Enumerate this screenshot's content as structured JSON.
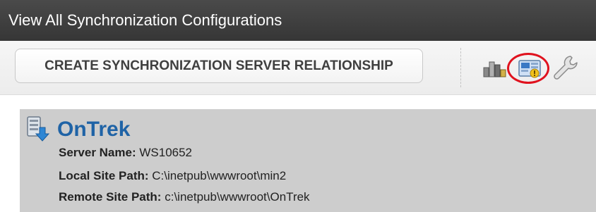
{
  "header": {
    "title": "View All Synchronization Configurations"
  },
  "toolbar": {
    "create_button_label": "CREATE SYNCHRONIZATION SERVER RELATIONSHIP",
    "icons": [
      "bar-chart-icon",
      "sync-config-icon",
      "wrench-icon"
    ],
    "highlight_color": "#e0121e"
  },
  "server": {
    "name_title": "OnTrek",
    "icon": "server-sync-icon",
    "fields": [
      {
        "label": "Server Name:",
        "value": "WS10652"
      },
      {
        "label": "Local Site Path:",
        "value": "C:\\inetpub\\wwwroot\\min2"
      },
      {
        "label": "Remote Site Path:",
        "value": "c:\\inetpub\\wwwroot\\OnTrek"
      }
    ],
    "title_color": "#1f63a6"
  }
}
